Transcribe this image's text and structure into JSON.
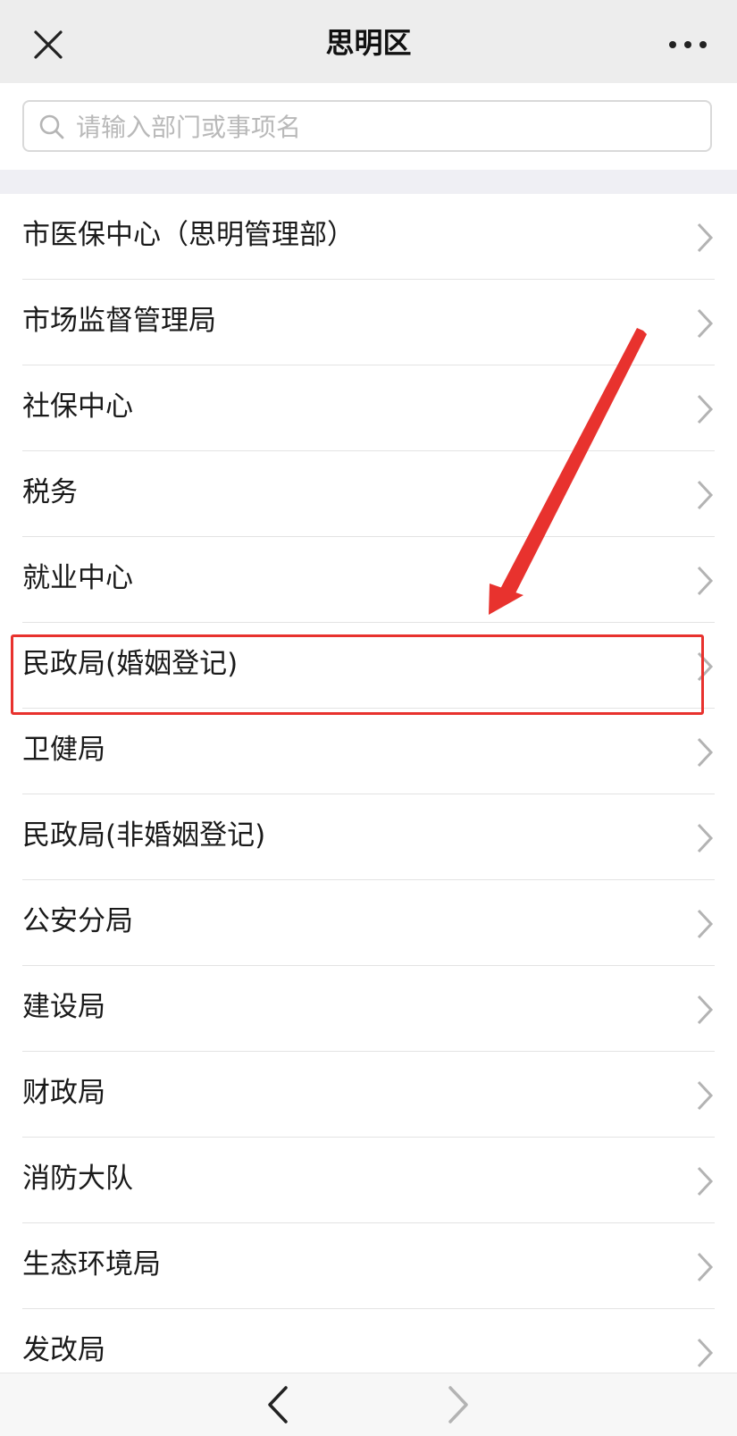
{
  "header": {
    "title": "思明区",
    "close_icon": "close-icon",
    "more_icon": "more-icon"
  },
  "search": {
    "placeholder": "请输入部门或事项名",
    "value": "",
    "icon": "search-icon"
  },
  "departments": [
    {
      "label": "市医保中心（思明管理部）"
    },
    {
      "label": "市场监督管理局"
    },
    {
      "label": "社保中心"
    },
    {
      "label": "税务"
    },
    {
      "label": "就业中心"
    },
    {
      "label": "民政局(婚姻登记)",
      "highlighted": true
    },
    {
      "label": "卫健局"
    },
    {
      "label": "民政局(非婚姻登记)"
    },
    {
      "label": "公安分局"
    },
    {
      "label": "建设局"
    },
    {
      "label": "财政局"
    },
    {
      "label": "消防大队"
    },
    {
      "label": "生态环境局"
    },
    {
      "label": "发改局"
    }
  ],
  "annotation": {
    "color": "#e8322e",
    "highlighted_item": "民政局(婚姻登记)"
  },
  "bottom_nav": {
    "back_icon": "chevron-left-icon",
    "forward_icon": "chevron-right-icon",
    "forward_enabled": false
  }
}
